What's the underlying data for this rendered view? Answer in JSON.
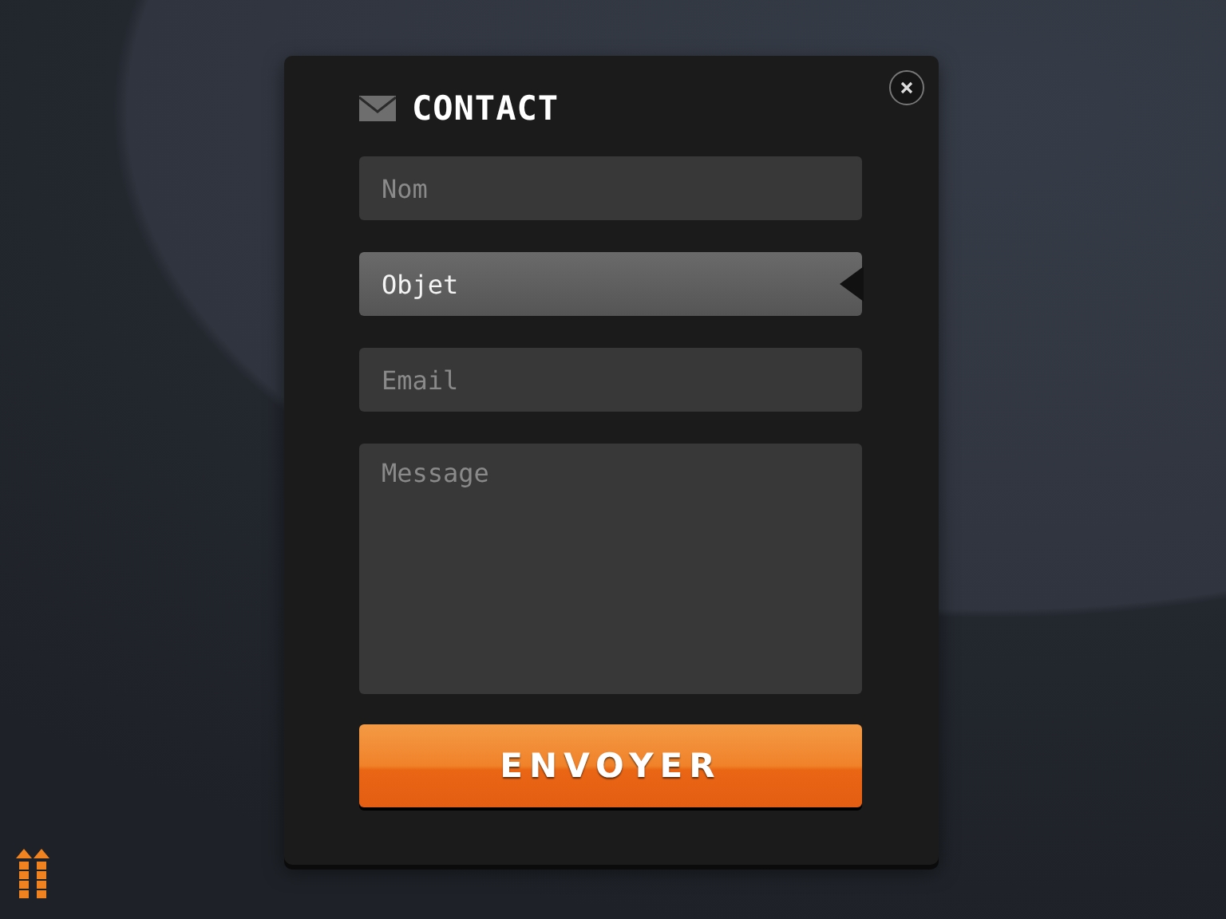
{
  "dialog": {
    "title": "CONTACT",
    "fields": [
      {
        "kind": "input",
        "placeholder": "Nom",
        "focused": false
      },
      {
        "kind": "input",
        "placeholder": "Objet",
        "focused": true
      },
      {
        "kind": "input",
        "placeholder": "Email",
        "focused": false
      },
      {
        "kind": "textarea",
        "placeholder": "Message",
        "focused": false
      }
    ],
    "submit": "ENVOYER"
  }
}
